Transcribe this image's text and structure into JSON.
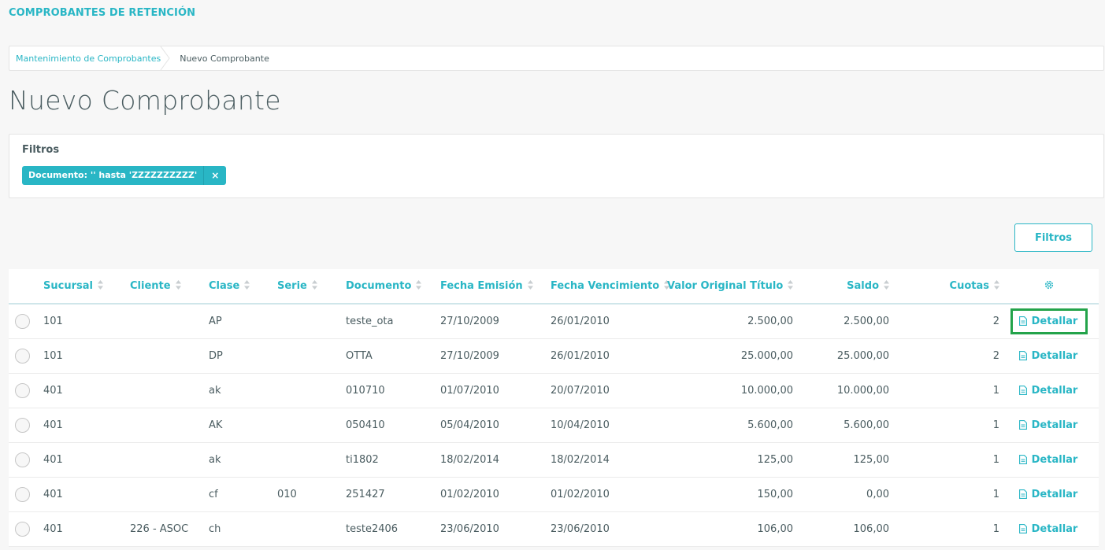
{
  "app": {
    "title": "COMPROBANTES DE RETENCIÓN"
  },
  "breadcrumb": {
    "parent": "Mantenimiento de Comprobantes",
    "current": "Nuevo Comprobante"
  },
  "page": {
    "title": "Nuevo Comprobante"
  },
  "filters": {
    "label": "Filtros",
    "chip_text": "Documento: '' hasta 'ZZZZZZZZZZ'",
    "chip_close": "×",
    "button_label": "Filtros"
  },
  "table": {
    "columns": [
      "Sucursal",
      "Cliente",
      "Clase",
      "Serie",
      "Documento",
      "Fecha Emisión",
      "Fecha Vencimiento",
      "Valor Original Título",
      "Saldo",
      "Cuotas"
    ],
    "detail_label": "Detallar",
    "rows": [
      {
        "sucursal": "101",
        "cliente": "",
        "clase": "AP",
        "serie": "",
        "documento": "teste_ota",
        "emision": "27/10/2009",
        "vencimiento": "26/01/2010",
        "valor": "2.500,00",
        "saldo": "2.500,00",
        "cuotas": "2"
      },
      {
        "sucursal": "101",
        "cliente": "",
        "clase": "DP",
        "serie": "",
        "documento": "OTTA",
        "emision": "27/10/2009",
        "vencimiento": "26/01/2010",
        "valor": "25.000,00",
        "saldo": "25.000,00",
        "cuotas": "2"
      },
      {
        "sucursal": "401",
        "cliente": "",
        "clase": "ak",
        "serie": "",
        "documento": "010710",
        "emision": "01/07/2010",
        "vencimiento": "20/07/2010",
        "valor": "10.000,00",
        "saldo": "10.000,00",
        "cuotas": "1"
      },
      {
        "sucursal": "401",
        "cliente": "",
        "clase": "AK",
        "serie": "",
        "documento": "050410",
        "emision": "05/04/2010",
        "vencimiento": "10/04/2010",
        "valor": "5.600,00",
        "saldo": "5.600,00",
        "cuotas": "1"
      },
      {
        "sucursal": "401",
        "cliente": "",
        "clase": "ak",
        "serie": "",
        "documento": "ti1802",
        "emision": "18/02/2014",
        "vencimiento": "18/02/2014",
        "valor": "125,00",
        "saldo": "125,00",
        "cuotas": "1"
      },
      {
        "sucursal": "401",
        "cliente": "",
        "clase": "cf",
        "serie": "010",
        "documento": "251427",
        "emision": "01/02/2010",
        "vencimiento": "01/02/2010",
        "valor": "150,00",
        "saldo": "0,00",
        "cuotas": "1"
      },
      {
        "sucursal": "401",
        "cliente": "226 - ASOC",
        "clase": "ch",
        "serie": "",
        "documento": "teste2406",
        "emision": "23/06/2010",
        "vencimiento": "23/06/2010",
        "valor": "106,00",
        "saldo": "106,00",
        "cuotas": "1"
      }
    ]
  },
  "icons": {
    "sort": "sort-icon",
    "settings": "gear-icon",
    "detail": "document-icon"
  },
  "colors": {
    "accent": "#29b6c5",
    "highlight": "#23a34a",
    "text": "#4a5c60"
  }
}
